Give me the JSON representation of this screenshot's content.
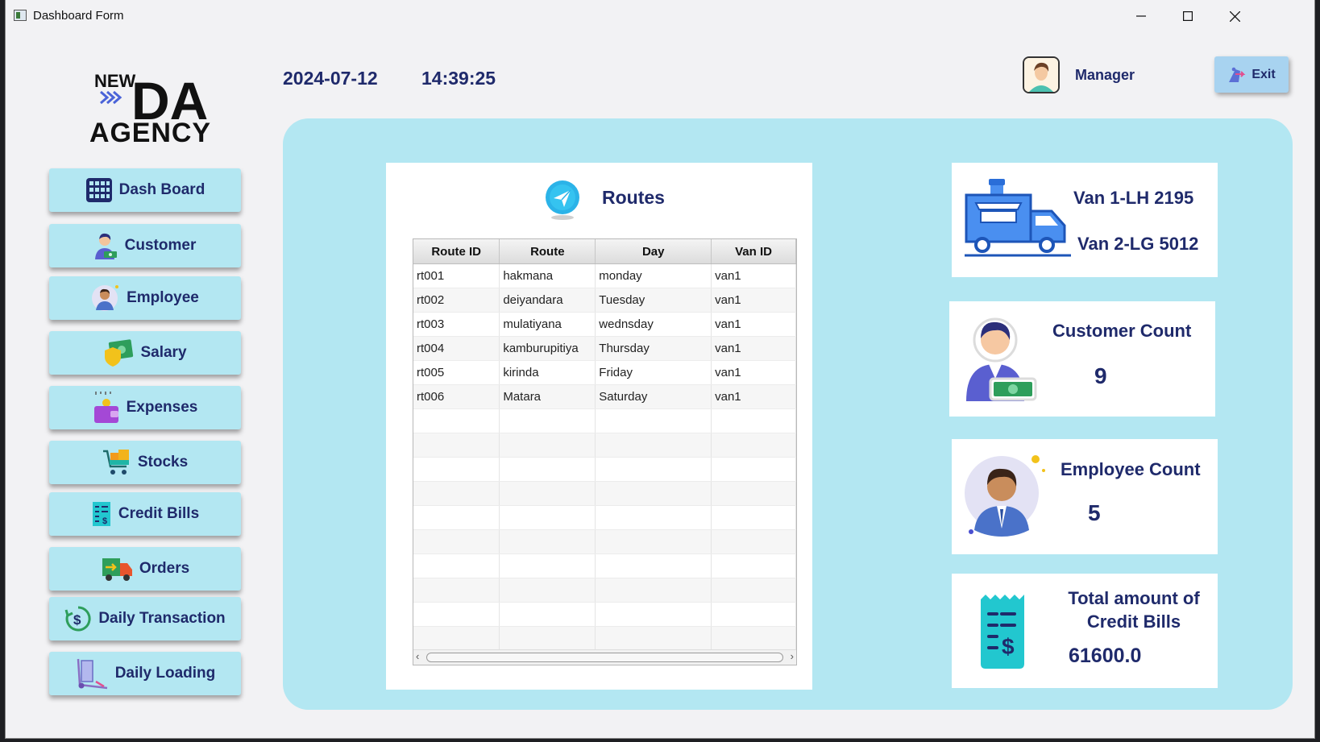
{
  "window": {
    "title": "Dashboard Form",
    "minimize": "—",
    "maximize": "☐",
    "close": "✕"
  },
  "logo": {
    "line1": "NEW",
    "line2": "DA",
    "line3": "AGENCY"
  },
  "header": {
    "date": "2024-07-12",
    "time": "14:39:25",
    "user_role": "Manager",
    "exit_label": "Exit"
  },
  "nav": [
    {
      "label": "Dash Board",
      "icon": "grid-icon"
    },
    {
      "label": "Customer",
      "icon": "customer-icon"
    },
    {
      "label": "Employee",
      "icon": "employee-icon"
    },
    {
      "label": "Salary",
      "icon": "salary-icon"
    },
    {
      "label": "Expenses",
      "icon": "wallet-icon"
    },
    {
      "label": "Stocks",
      "icon": "cart-icon"
    },
    {
      "label": "Credit Bills",
      "icon": "bill-icon"
    },
    {
      "label": "Orders",
      "icon": "truck-icon"
    },
    {
      "label": "Daily Transaction",
      "icon": "dollar-cycle-icon"
    },
    {
      "label": "Daily Loading",
      "icon": "hand-truck-icon"
    }
  ],
  "routes": {
    "title": "Routes",
    "columns": [
      "Route ID",
      "Route",
      "Day",
      "Van ID"
    ],
    "rows": [
      [
        "rt001",
        "hakmana",
        "monday",
        "van1"
      ],
      [
        "rt002",
        "deiyandara",
        "Tuesday",
        "van1"
      ],
      [
        "rt003",
        "mulatiyana",
        "wednsday",
        "van1"
      ],
      [
        "rt004",
        "kamburupitiya",
        "Thursday",
        "van1"
      ],
      [
        "rt005",
        "kirinda",
        "Friday",
        "van1"
      ],
      [
        "rt006",
        "Matara",
        "Saturday",
        "van1"
      ]
    ]
  },
  "vans": {
    "van1": "Van 1-LH 2195",
    "van2": "Van 2-LG 5012"
  },
  "customer_count": {
    "label": "Customer Count",
    "value": "9"
  },
  "employee_count": {
    "label": "Employee Count",
    "value": "5"
  },
  "credit_bills": {
    "label_line1": "Total amount of",
    "label_line2": "Credit Bills",
    "value": "61600.0"
  },
  "colors": {
    "accent": "#b3e7f2",
    "text": "#1f2a6b",
    "exit": "#a8d3f0"
  }
}
